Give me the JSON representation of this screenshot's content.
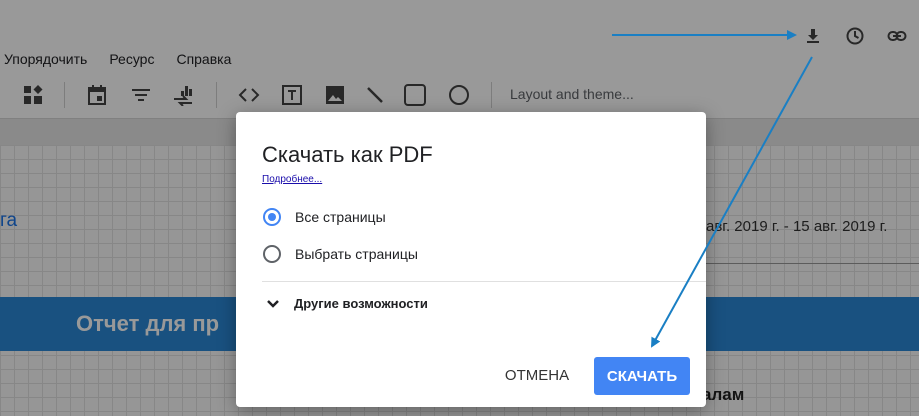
{
  "menu": {
    "items": [
      "Упорядочить",
      "Ресурс",
      "Справка"
    ]
  },
  "header_icons": [
    "download-icon",
    "history-icon",
    "link-icon"
  ],
  "toolbar": {
    "tools": [
      "add-chart-icon",
      "date-range-icon",
      "filter-icon",
      "data-control-icon",
      "embed-icon",
      "text-icon",
      "image-icon",
      "line-icon",
      "rectangle-icon",
      "circle-icon"
    ],
    "theme_label": "Layout and theme..."
  },
  "report": {
    "left_fragment": "га",
    "date_range": "авг. 2019 г. - 15 авг. 2019 г.",
    "band_title": "Отчет для пр",
    "bottom_fragment": "алам"
  },
  "dialog": {
    "title": "Скачать как PDF",
    "learn_more": "Подробнее...",
    "options": [
      {
        "label": "Все страницы",
        "selected": true
      },
      {
        "label": "Выбрать страницы",
        "selected": false
      }
    ],
    "more_label": "Другие возможности",
    "cancel_label": "ОТМЕНА",
    "download_label": "СКАЧАТЬ"
  },
  "colors": {
    "accent": "#4285f4",
    "band": "#2a88d6",
    "annotation_arrow": "#1a7fc4"
  }
}
